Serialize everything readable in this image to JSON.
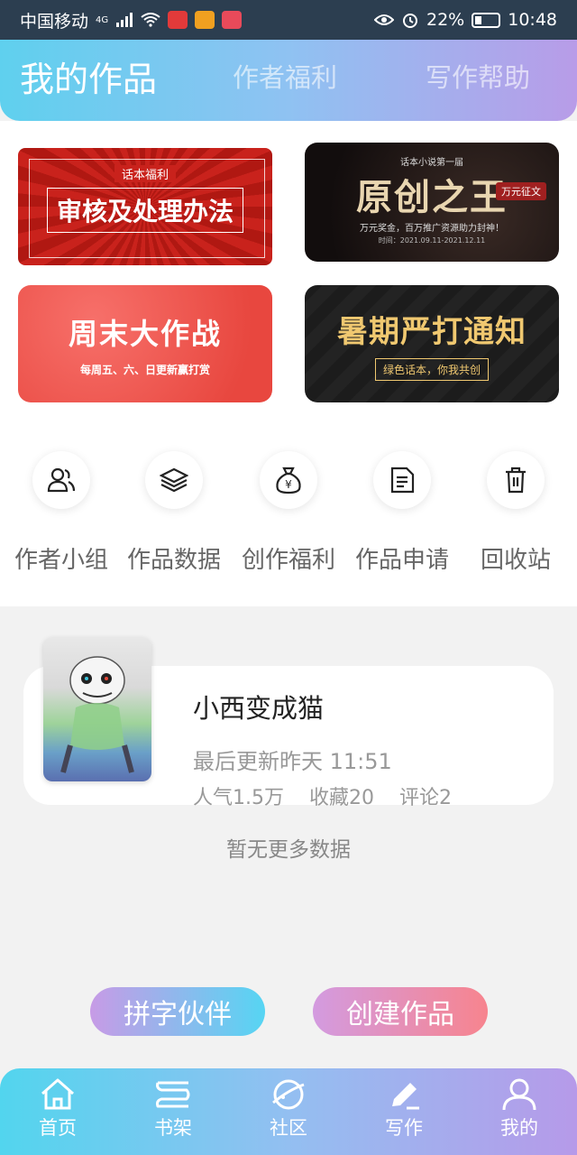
{
  "status_bar": {
    "carrier": "中国移动",
    "network": "4G",
    "battery": "22%",
    "time": "10:48"
  },
  "header": {
    "tabs": [
      {
        "label": "我的作品",
        "active": true
      },
      {
        "label": "作者福利",
        "active": false
      },
      {
        "label": "写作帮助",
        "active": false
      }
    ]
  },
  "banners": [
    {
      "tag": "话本福利",
      "title": "审核及处理办法"
    },
    {
      "tag": "话本小说第一届",
      "title": "原创之王",
      "badge": "万元征文",
      "subtitle": "万元奖金，百万推广资源助力封神！",
      "period": "时间：2021.09.11-2021.12.11"
    },
    {
      "title": "周末大作战",
      "subtitle": "每周五、六、日更新赢打赏"
    },
    {
      "title": "暑期严打通知",
      "subtitle": "绿色话本，你我共创"
    }
  ],
  "quick_actions": [
    {
      "label": "作者小组",
      "icon": "users-icon"
    },
    {
      "label": "作品数据",
      "icon": "layers-icon"
    },
    {
      "label": "创作福利",
      "icon": "money-bag-icon"
    },
    {
      "label": "作品申请",
      "icon": "document-icon"
    },
    {
      "label": "回收站",
      "icon": "trash-icon"
    }
  ],
  "work": {
    "title": "小西变成猫",
    "updated": "最后更新昨天 11:51",
    "popularity": "人气1.5万",
    "favorites": "收藏20",
    "comments": "评论2"
  },
  "no_more": "暂无更多数据",
  "buttons": {
    "partner": "拼字伙伴",
    "create": "创建作品"
  },
  "bottom_nav": [
    {
      "label": "首页",
      "icon": "home-icon"
    },
    {
      "label": "书架",
      "icon": "bookshelf-icon"
    },
    {
      "label": "社区",
      "icon": "planet-icon"
    },
    {
      "label": "写作",
      "icon": "pen-icon",
      "active": true
    },
    {
      "label": "我的",
      "icon": "profile-icon"
    }
  ]
}
